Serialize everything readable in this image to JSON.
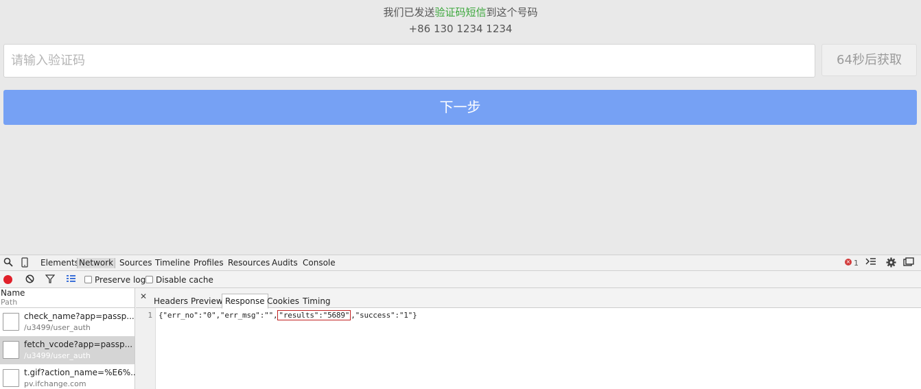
{
  "page": {
    "sent_prefix": "我们已发送",
    "sent_highlight": "验证码短信",
    "sent_suffix": "到这个号码",
    "phone": "+86 130 1234 1234",
    "code_placeholder": "请输入验证码",
    "countdown_label": "64秒后获取",
    "next_label": "下一步",
    "highlight_color": "#3aa63a",
    "next_button_color": "#76a1f4"
  },
  "devtools": {
    "tabs": [
      "Elements",
      "Network",
      "Sources",
      "Timeline",
      "Profiles",
      "Resources",
      "Audits",
      "Console"
    ],
    "active_tab": "Network",
    "error_count": "1",
    "toolbar": {
      "preserve_log": "Preserve log",
      "disable_cache": "Disable cache"
    },
    "columns": {
      "name": "Name",
      "path": "Path"
    },
    "requests": [
      {
        "name": "check_name?app=passp...",
        "path": "/u3499/user_auth"
      },
      {
        "name": "fetch_vcode?app=passp...",
        "path": "/u3499/user_auth"
      },
      {
        "name": "t.gif?action_name=%E6%...",
        "path": "pv.ifchange.com"
      }
    ],
    "detail_tabs": [
      "Headers",
      "Preview",
      "Response",
      "Cookies",
      "Timing"
    ],
    "active_detail_tab": "Response",
    "response": {
      "line_number": "1",
      "part1": "{\"err_no\":\"0\",\"err_msg\":\"\",",
      "highlight": "\"results\":\"5689\"",
      "part2": ",\"success\":\"1\"}"
    }
  }
}
